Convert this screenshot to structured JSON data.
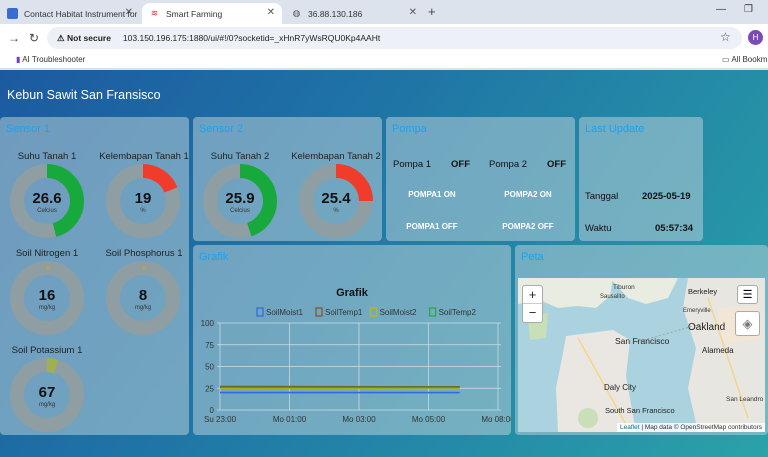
{
  "browser": {
    "tabs": [
      {
        "label": "Contact Habitat Instrument for"
      },
      {
        "label": "Smart Farming"
      },
      {
        "label": "36.88.130.186"
      }
    ],
    "security": "Not secure",
    "url": "103.150.196.175:1880/ui/#!/0?socketid=_xHnR7yWsRQU0Kp4AAHt",
    "bookmark": "AI Troubleshooter",
    "all_bookmarks": "All Bookm",
    "avatar": "H"
  },
  "dashboard": {
    "title": "Kebun Sawit San Fransisco",
    "sensor1": {
      "title": "Sensor 1",
      "gauges": [
        {
          "label": "Suhu Tanah 1",
          "value": "26.6",
          "unit": "Celcius",
          "fill": 0.46,
          "color": "#17a93c"
        },
        {
          "label": "Kelembapan Tanah 1",
          "value": "19",
          "unit": "%",
          "fill": 0.19,
          "color": "#f03c2a"
        },
        {
          "label": "Soil Nitrogen 1",
          "value": "16",
          "unit": "mg/kg",
          "fill": 0.01,
          "color": "#d0a020"
        },
        {
          "label": "Soil Phosphorus 1",
          "value": "8",
          "unit": "mg/kg",
          "fill": 0.01,
          "color": "#d0a020"
        },
        {
          "label": "Soil Potassium 1",
          "value": "67",
          "unit": "mg/kg",
          "fill": 0.05,
          "color": "#a0b050"
        }
      ]
    },
    "sensor2": {
      "title": "Sensor 2",
      "gauges": [
        {
          "label": "Suhu Tanah 2",
          "value": "25.9",
          "unit": "Celcius",
          "fill": 0.45,
          "color": "#17a93c"
        },
        {
          "label": "Kelembapan Tanah 2",
          "value": "25.4",
          "unit": "%",
          "fill": 0.25,
          "color": "#f03c2a"
        }
      ]
    },
    "pompa": {
      "title": "Pompa",
      "pompa1_label": "Pompa 1",
      "pompa1_state": "OFF",
      "pompa2_label": "Pompa 2",
      "pompa2_state": "OFF",
      "btn_p1_on": "POMPA1 ON",
      "btn_p2_on": "POMPA2 ON",
      "btn_p1_off": "POMPA1 OFF",
      "btn_p2_off": "POMPA2 OFF"
    },
    "last_update": {
      "title": "Last Update",
      "tanggal_label": "Tanggal",
      "tanggal": "2025-05-19",
      "waktu_label": "Waktu",
      "waktu": "05:57:34"
    },
    "grafik": {
      "title": "Grafik",
      "chart_title": "Grafik"
    },
    "peta": {
      "title": "Peta",
      "zoom_in": "+",
      "zoom_out": "−",
      "attribution_link": "Leaflet",
      "attribution": "| Map data © OpenStreetMap contributors",
      "places": [
        {
          "name": "Tiburon"
        },
        {
          "name": "Berkeley"
        },
        {
          "name": "Sausalito"
        },
        {
          "name": "Emeryville"
        },
        {
          "name": "Oakland"
        },
        {
          "name": "San Francisco"
        },
        {
          "name": "Alameda"
        },
        {
          "name": "Daly City"
        },
        {
          "name": "South San Francisco"
        },
        {
          "name": "San Leandro"
        }
      ]
    }
  },
  "chart_data": {
    "type": "line",
    "title": "Grafik",
    "legend": [
      "SoilMoist1",
      "SoilTemp1",
      "SoilMoist2",
      "SoilTemp2"
    ],
    "legend_position": "top",
    "x_ticks": [
      "Su 23:00",
      "Mo 01:00",
      "Mo 03:00",
      "Mo 05:00",
      "Mo 08:00"
    ],
    "y_ticks": [
      "100",
      "75",
      "50",
      "25",
      "0"
    ],
    "ylim": [
      0,
      100
    ],
    "series": [
      {
        "name": "SoilMoist1",
        "color": "#2f6be0",
        "x": [
          "Su 23:00",
          "Mo 05:30"
        ],
        "values": [
          20,
          20
        ]
      },
      {
        "name": "SoilTemp1",
        "color": "#8c4a2a",
        "x": [
          "Su 23:00",
          "Mo 05:30"
        ],
        "values": [
          27,
          26.6
        ]
      },
      {
        "name": "SoilMoist2",
        "color": "#c9b400",
        "x": [
          "Su 23:00",
          "Mo 05:30"
        ],
        "values": [
          25,
          25.4
        ]
      },
      {
        "name": "SoilTemp2",
        "color": "#27a83a",
        "x": [
          "Su 23:00",
          "Mo 05:30"
        ],
        "values": [
          26,
          25.9
        ]
      }
    ],
    "grid": true
  }
}
